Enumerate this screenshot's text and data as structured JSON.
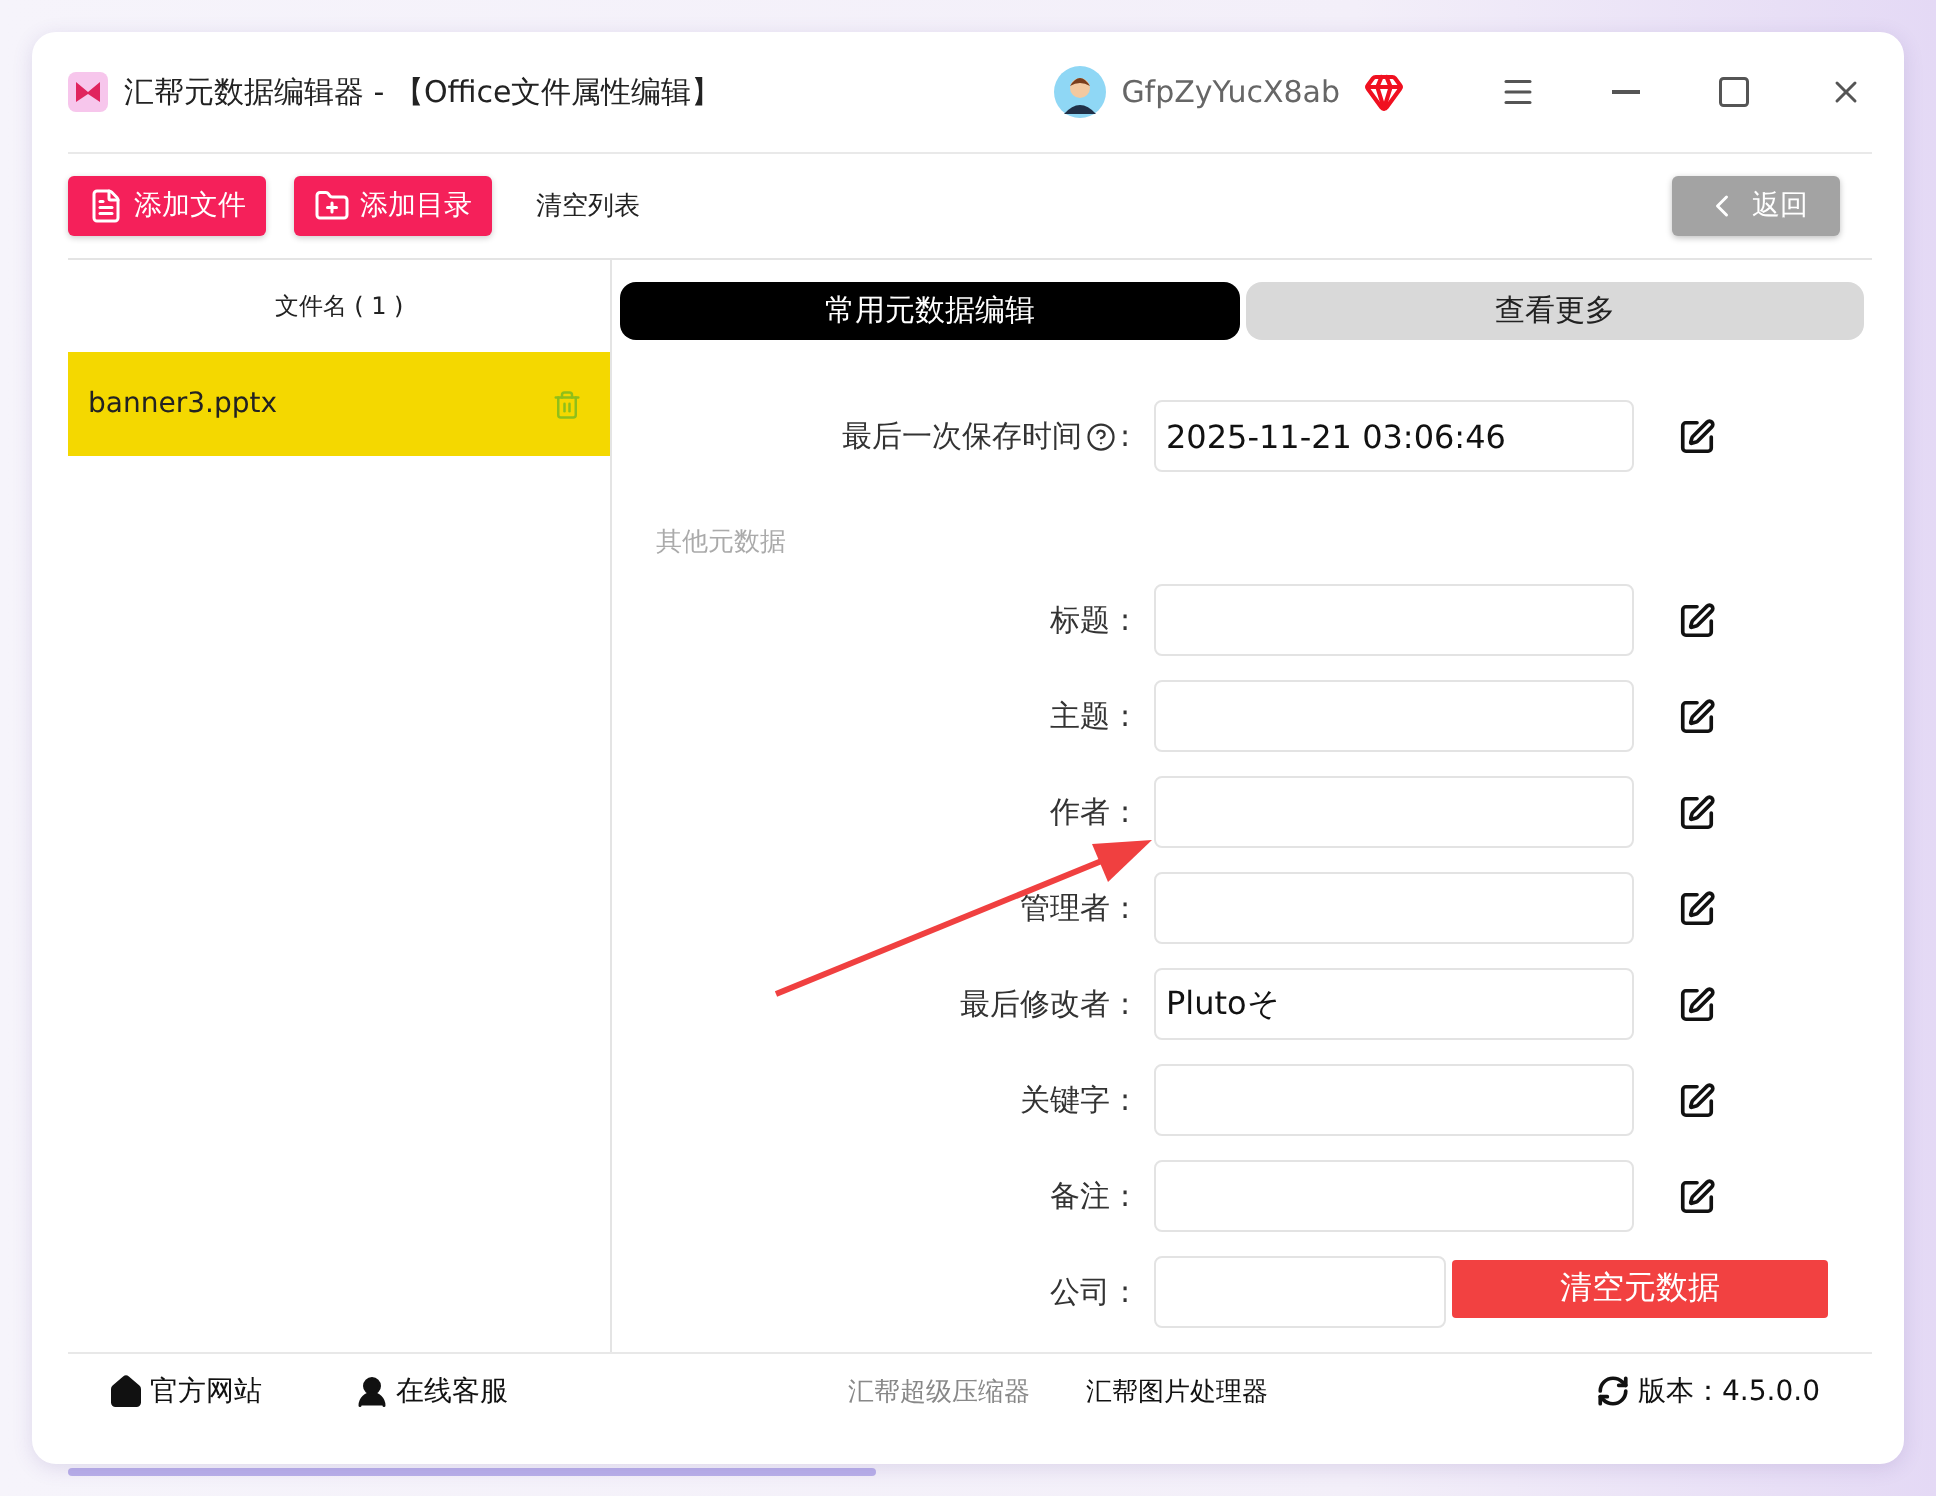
{
  "window": {
    "title": "汇帮元数据编辑器 - 【Office文件属性编辑】"
  },
  "user": {
    "name": "GfpZyYucX8ab"
  },
  "toolbar": {
    "buttons": [
      {
        "label": "添加文件",
        "kind": "file"
      },
      {
        "label": "添加目录",
        "kind": "folder"
      }
    ],
    "clear": "清空列表",
    "back": "返回"
  },
  "file_list": {
    "header": "文件名 ( 1 )",
    "files": [
      {
        "name": "banner3.pptx",
        "selected": true
      }
    ]
  },
  "tabs": [
    {
      "label": "常用元数据编辑",
      "selected": true
    },
    {
      "label": "查看更多",
      "selected": false
    }
  ],
  "time_fields": [
    {
      "label": "最后一次保存时间",
      "colon": ":",
      "value": "2025-11-21 03:06:46"
    }
  ],
  "other_section": {
    "title": "其他元数据",
    "fields": [
      {
        "label": "标题 :"
      },
      {
        "label": "主题 :"
      },
      {
        "label": "作者 :"
      },
      {
        "label": "管理者 :"
      },
      {
        "label": "最后修改者 :",
        "value": "Plutoそ"
      },
      {
        "label": "关键字 :"
      },
      {
        "label": "备注 :"
      },
      {
        "label": "公司 :"
      }
    ]
  },
  "clear_metadata": "清空元数据",
  "footer": {
    "website": "官方网站",
    "support": "在线客服",
    "products": [
      {
        "label": "汇帮超级压缩器",
        "muted": true
      },
      {
        "label": "汇帮图片处理器",
        "muted": false
      }
    ],
    "version": "版本：4.5.0.0"
  }
}
